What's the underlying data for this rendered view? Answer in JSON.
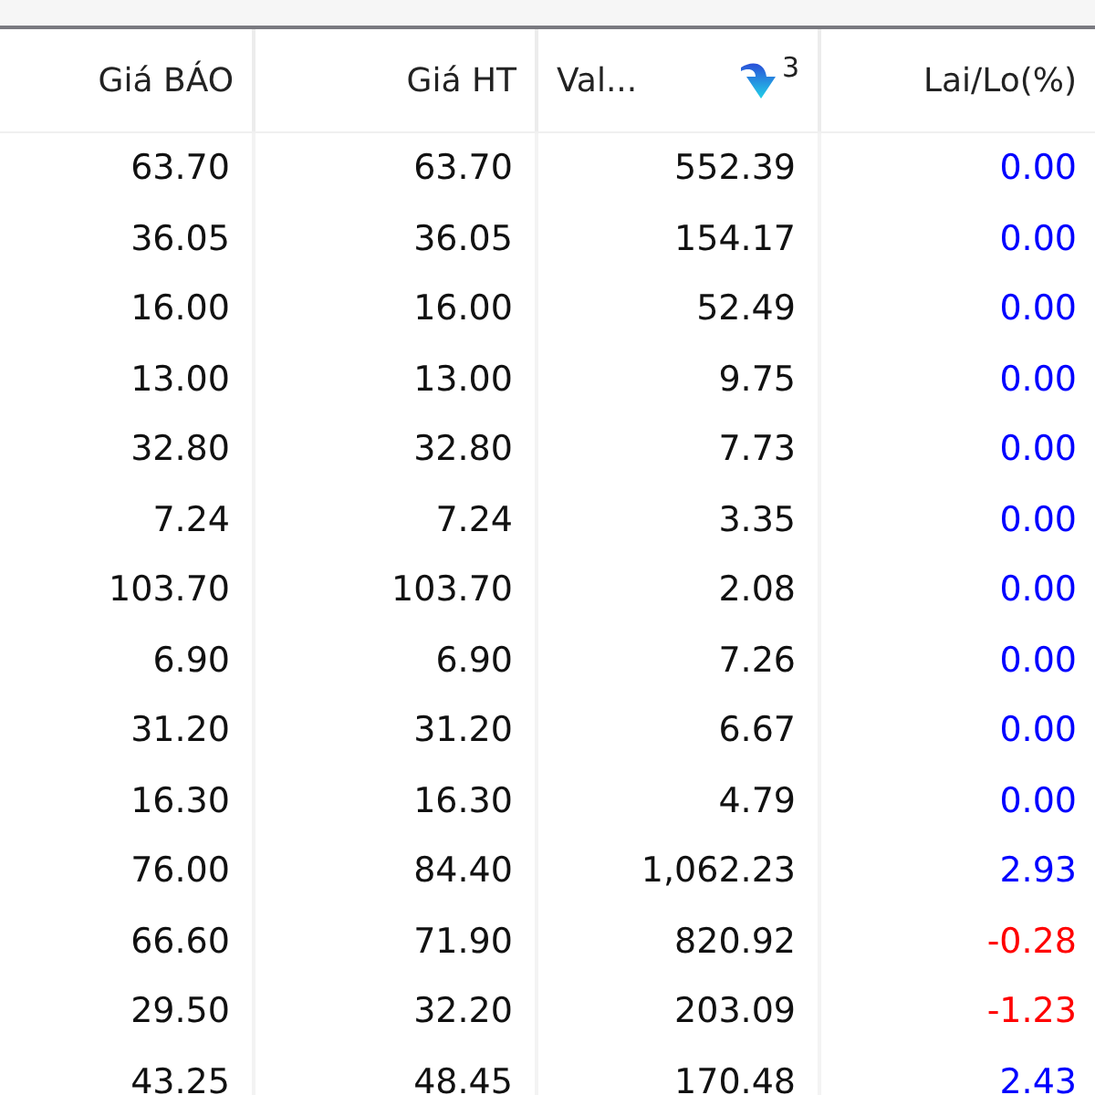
{
  "columns": [
    {
      "label": "Giá BÁO",
      "sorted": false
    },
    {
      "label": "Giá HT",
      "sorted": false
    },
    {
      "label": "Val...",
      "sorted": true,
      "sort_rank": "3"
    },
    {
      "label": "Lai/Lo(%)",
      "sorted": false
    }
  ],
  "rows": [
    {
      "cells": [
        "63.70",
        "63.70",
        "552.39",
        "0.00"
      ],
      "color": "#0000ff"
    },
    {
      "cells": [
        "36.05",
        "36.05",
        "154.17",
        "0.00"
      ],
      "color": "#0000ff"
    },
    {
      "cells": [
        "16.00",
        "16.00",
        "52.49",
        "0.00"
      ],
      "color": "#0000ff"
    },
    {
      "cells": [
        "13.00",
        "13.00",
        "9.75",
        "0.00"
      ],
      "color": "#0000ff"
    },
    {
      "cells": [
        "32.80",
        "32.80",
        "7.73",
        "0.00"
      ],
      "color": "#0000ff"
    },
    {
      "cells": [
        "7.24",
        "7.24",
        "3.35",
        "0.00"
      ],
      "color": "#0000ff"
    },
    {
      "cells": [
        "103.70",
        "103.70",
        "2.08",
        "0.00"
      ],
      "color": "#0000ff"
    },
    {
      "cells": [
        "6.90",
        "6.90",
        "7.26",
        "0.00"
      ],
      "color": "#0000ff"
    },
    {
      "cells": [
        "31.20",
        "31.20",
        "6.67",
        "0.00"
      ],
      "color": "#0000ff"
    },
    {
      "cells": [
        "16.30",
        "16.30",
        "4.79",
        "0.00"
      ],
      "color": "#0000ff"
    },
    {
      "cells": [
        "76.00",
        "84.40",
        "1,062.23",
        "2.93"
      ],
      "color": "#0000ff"
    },
    {
      "cells": [
        "66.60",
        "71.90",
        "820.92",
        "-0.28"
      ],
      "color": "#ff0000"
    },
    {
      "cells": [
        "29.50",
        "32.20",
        "203.09",
        "-1.23"
      ],
      "color": "#ff0000"
    },
    {
      "cells": [
        "43.25",
        "48.45",
        "170.48",
        "2.43"
      ],
      "color": "#0000ff"
    }
  ]
}
